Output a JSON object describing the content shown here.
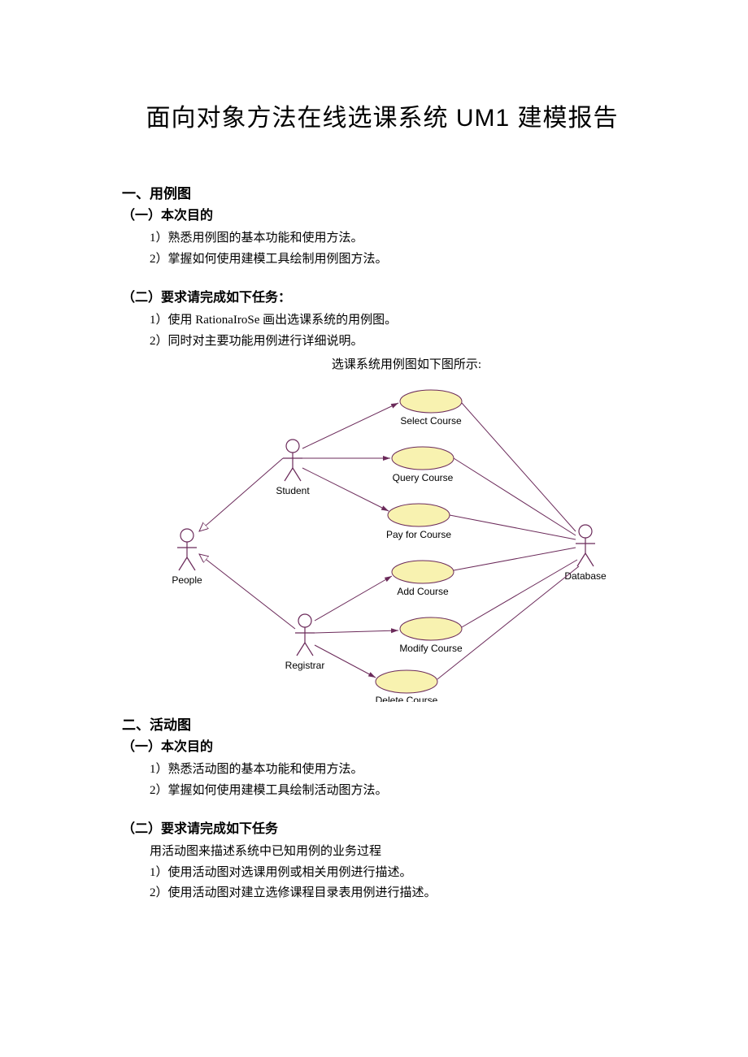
{
  "title": "面向对象方法在线选课系统 UM1 建模报告",
  "section1": {
    "heading": "一、用例图",
    "sub1": {
      "heading": "（一）本次目的",
      "items": [
        "1）熟悉用例图的基本功能和使用方法。",
        "2）掌握如何使用建模工具绘制用例图方法。"
      ]
    },
    "sub2": {
      "heading": "（二）要求请完成如下任务：",
      "items": [
        "1）使用 RationaIroSe 画出选课系统的用例图。",
        "2）同时对主要功能用例进行详细说明。"
      ],
      "caption": "选课系统用例图如下图所示:"
    }
  },
  "diagram": {
    "actors": {
      "people": "People",
      "student": "Student",
      "registrar": "Registrar",
      "database": "Database"
    },
    "usecases": [
      "Select Course",
      "Query Course",
      "Pay for Course",
      "Add Course",
      "Modify Course",
      "Delete Course"
    ]
  },
  "section2": {
    "heading": "二、活动图",
    "sub1": {
      "heading": "（一）本次目的",
      "items": [
        "1）熟悉活动图的基本功能和使用方法。",
        "2）掌握如何使用建模工具绘制活动图方法。"
      ]
    },
    "sub2": {
      "heading": "（二）要求请完成如下任务",
      "intro": "用活动图来描述系统中已知用例的业务过程",
      "items": [
        "1）使用活动图对选课用例或相关用例进行描述。",
        "2）使用活动图对建立选修课程目录表用例进行描述。"
      ]
    }
  }
}
